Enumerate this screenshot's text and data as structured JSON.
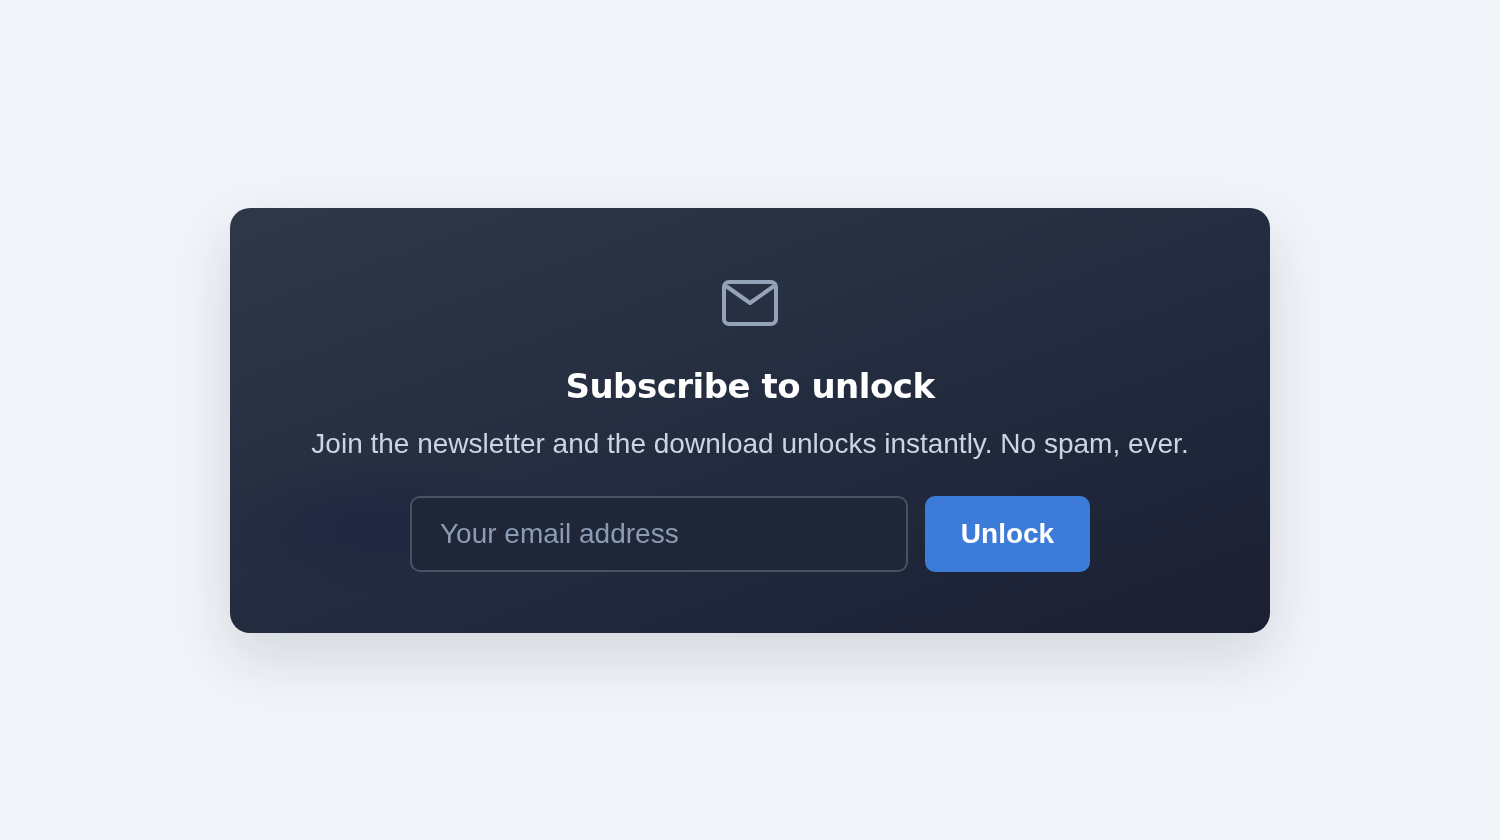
{
  "card": {
    "title": "Subscribe to unlock",
    "subtitle": "Join the newsletter and the download unlocks instantly. No spam, ever.",
    "email_field": {
      "placeholder": "Your email address"
    },
    "button": "Unlock"
  }
}
